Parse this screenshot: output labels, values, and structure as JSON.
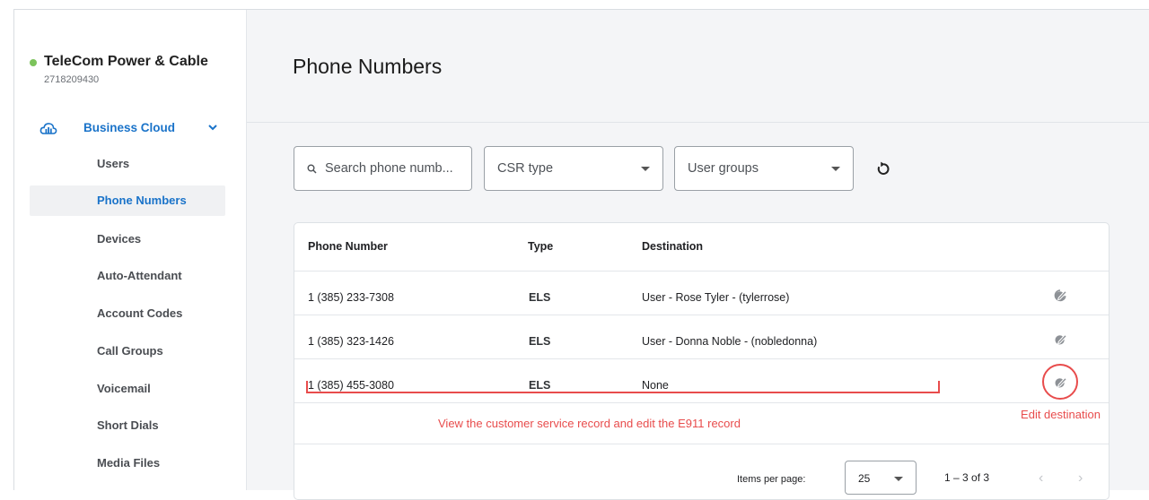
{
  "account": {
    "name": "TeleCom Power & Cable",
    "number": "2718209430",
    "status_color": "#7cc35b"
  },
  "sidebar": {
    "section": {
      "label": "Business Cloud",
      "icon": "cloud-icon",
      "expanded": true
    },
    "items": [
      {
        "label": "Users",
        "active": false
      },
      {
        "label": "Phone Numbers",
        "active": true
      },
      {
        "label": "Devices",
        "active": false
      },
      {
        "label": "Auto-Attendant",
        "active": false
      },
      {
        "label": "Account Codes",
        "active": false
      },
      {
        "label": "Call Groups",
        "active": false
      },
      {
        "label": "Voicemail",
        "active": false
      },
      {
        "label": "Short Dials",
        "active": false
      },
      {
        "label": "Media Files",
        "active": false
      }
    ]
  },
  "page": {
    "title": "Phone Numbers"
  },
  "filters": {
    "search_placeholder": "Search phone numb...",
    "csr_type": "CSR type",
    "user_groups": "User groups"
  },
  "table": {
    "headers": [
      "Phone Number",
      "Type",
      "Destination"
    ],
    "rows": [
      {
        "phone": "1 (385) 233-7308",
        "type": "ELS",
        "destination": "User - Rose Tyler - (tylerrose)"
      },
      {
        "phone": "1 (385) 323-1426",
        "type": "ELS",
        "destination": "User - Donna Noble - (nobledonna)"
      },
      {
        "phone": "1 (385) 455-3080",
        "type": "ELS",
        "destination": "None"
      }
    ]
  },
  "annotations": {
    "row_note": "View the customer service record and edit the E911 record",
    "icon_note": "Edit destination",
    "color": "#e84c4c"
  },
  "pagination": {
    "items_per_page_label": "Items per page:",
    "items_per_page": "25",
    "range": "1 – 3 of 3"
  },
  "colors": {
    "accent": "#1a73c9",
    "main_bg": "#f4f5f7"
  }
}
